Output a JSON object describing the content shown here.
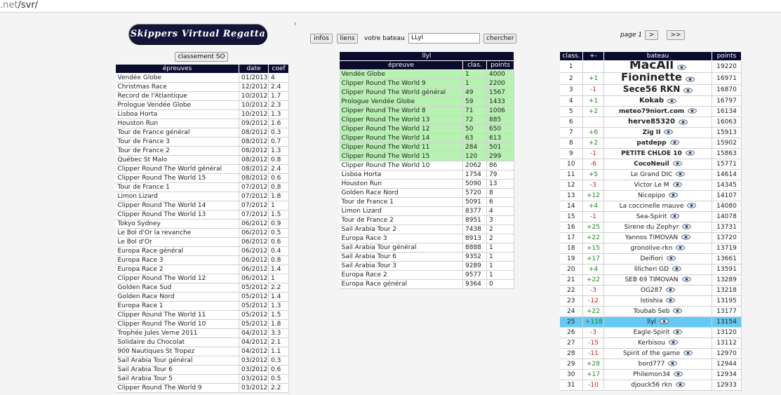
{
  "url": {
    "dim": ".net",
    "path": "/svr/"
  },
  "stray_char": "³",
  "logo_text": "Skippers Virtual Regatta",
  "classement_btn": "classement SO",
  "toolbar": {
    "infos": "infos",
    "liens": "liens",
    "votre_bateau_label": "votre bateau",
    "boat_input_value": "LLyl",
    "chercher": "chercher"
  },
  "pager": {
    "label": "page 1",
    "next": ">",
    "last": ">>"
  },
  "left_table": {
    "headers": [
      "épreuves",
      "date",
      "coef"
    ],
    "rows": [
      [
        "Vendée Globe",
        "01/2013",
        "4"
      ],
      [
        "Christmas Race",
        "12/2012",
        "2.4"
      ],
      [
        "Record de l'Atlantique",
        "10/2012",
        "1.7"
      ],
      [
        "Prologue Vendée Globe",
        "10/2012",
        "2.3"
      ],
      [
        "Lisboa Horta",
        "10/2012",
        "1.3"
      ],
      [
        "Houston Run",
        "09/2012",
        "1.6"
      ],
      [
        "Tour de France général",
        "08/2012",
        "0.3"
      ],
      [
        "Tour de France 3",
        "08/2012",
        "0.7"
      ],
      [
        "Tour de France 2",
        "08/2012",
        "1.3"
      ],
      [
        "Québec St Malo",
        "08/2012",
        "0.8"
      ],
      [
        "Clipper Round The World général",
        "08/2012",
        "2.4"
      ],
      [
        "Clipper Round The World 15",
        "08/2012",
        "0.6"
      ],
      [
        "Tour de France 1",
        "07/2012",
        "0.8"
      ],
      [
        "Limon Lizard",
        "07/2012",
        "1.8"
      ],
      [
        "Clipper Round The World 14",
        "07/2012",
        "1"
      ],
      [
        "Clipper Round The World 13",
        "07/2012",
        "1.5"
      ],
      [
        "Tokyo Sydney",
        "06/2012",
        "0.9"
      ],
      [
        "Le Bol d'Or la revanche",
        "06/2012",
        "0.5"
      ],
      [
        "Le Bol d'Or",
        "06/2012",
        "0.6"
      ],
      [
        "Europa Race général",
        "06/2012",
        "0.4"
      ],
      [
        "Europa Race 3",
        "06/2012",
        "0.8"
      ],
      [
        "Europa Race 2",
        "06/2012",
        "1.4"
      ],
      [
        "Clipper Round The World 12",
        "06/2012",
        "1"
      ],
      [
        "Golden Race Sud",
        "05/2012",
        "2.2"
      ],
      [
        "Golden Race Nord",
        "05/2012",
        "1.4"
      ],
      [
        "Europa Race 1",
        "05/2012",
        "1.3"
      ],
      [
        "Clipper Round The World 11",
        "05/2012",
        "1.5"
      ],
      [
        "Clipper Round The World 10",
        "05/2012",
        "1.8"
      ],
      [
        "Trophée Jules Verne 2011",
        "04/2012",
        "3.3"
      ],
      [
        "Solidaire du Chocolat",
        "04/2012",
        "2.1"
      ],
      [
        "900 Nautiques St Tropez",
        "04/2012",
        "1.1"
      ],
      [
        "Sail Arabia Tour général",
        "03/2012",
        "0.3"
      ],
      [
        "Sail Arabia Tour 6",
        "03/2012",
        "0.6"
      ],
      [
        "Sail Arabia Tour 5",
        "03/2012",
        "0.5"
      ],
      [
        "Clipper Round The World 9",
        "03/2012",
        "2.2"
      ]
    ]
  },
  "mid_table": {
    "boat_name": "llyl",
    "headers": [
      "épreuve",
      "clas.",
      "points"
    ],
    "rows": [
      {
        "race": "Vendée Globe",
        "clas": "1",
        "points": "4000",
        "hl": true
      },
      {
        "race": "Clipper Round The World 9",
        "clas": "1",
        "points": "2200",
        "hl": true
      },
      {
        "race": "Clipper Round The World général",
        "clas": "49",
        "points": "1567",
        "hl": true
      },
      {
        "race": "Prologue Vendée Globe",
        "clas": "59",
        "points": "1433",
        "hl": true
      },
      {
        "race": "Clipper Round The World 8",
        "clas": "71",
        "points": "1006",
        "hl": true
      },
      {
        "race": "Clipper Round The World 13",
        "clas": "72",
        "points": "885",
        "hl": true
      },
      {
        "race": "Clipper Round The World 12",
        "clas": "50",
        "points": "650",
        "hl": true
      },
      {
        "race": "Clipper Round The World 14",
        "clas": "63",
        "points": "613",
        "hl": true
      },
      {
        "race": "Clipper Round The World 11",
        "clas": "284",
        "points": "501",
        "hl": true
      },
      {
        "race": "Clipper Round The World 15",
        "clas": "120",
        "points": "299",
        "hl": true
      },
      {
        "race": "Clipper Round The World 10",
        "clas": "2062",
        "points": "86",
        "hl": false
      },
      {
        "race": "Lisboa Horta",
        "clas": "1754",
        "points": "79",
        "hl": false
      },
      {
        "race": "Houston Run",
        "clas": "5090",
        "points": "13",
        "hl": false
      },
      {
        "race": "Golden Race Nord",
        "clas": "5720",
        "points": "8",
        "hl": false
      },
      {
        "race": "Tour de France 1",
        "clas": "5091",
        "points": "6",
        "hl": false
      },
      {
        "race": "Limon Lizard",
        "clas": "8377",
        "points": "4",
        "hl": false
      },
      {
        "race": "Tour de France 2",
        "clas": "8951",
        "points": "3",
        "hl": false
      },
      {
        "race": "Sail Arabia Tour 2",
        "clas": "7438",
        "points": "2",
        "hl": false
      },
      {
        "race": "Europa Race 3",
        "clas": "8913",
        "points": "2",
        "hl": false
      },
      {
        "race": "Sail Arabia Tour général",
        "clas": "8888",
        "points": "1",
        "hl": false
      },
      {
        "race": "Sail Arabia Tour 6",
        "clas": "9352",
        "points": "1",
        "hl": false
      },
      {
        "race": "Sail Arabia Tour 3",
        "clas": "9289",
        "points": "1",
        "hl": false
      },
      {
        "race": "Europa Race 2",
        "clas": "9577",
        "points": "1",
        "hl": false
      },
      {
        "race": "Europa Race général",
        "clas": "9364",
        "points": "0",
        "hl": false
      }
    ]
  },
  "right_table": {
    "headers": [
      "class.",
      "+-",
      "bateau",
      "points"
    ],
    "colors": {
      "positive": "#1a8a1a",
      "negative": "#d02020",
      "highlight": "#65c9f4"
    },
    "rows": [
      {
        "rank": "1",
        "delta": "",
        "boat": "MacAll",
        "points": "19220",
        "size": 17,
        "bold": true
      },
      {
        "rank": "2",
        "delta": "+1",
        "boat": "Fioninette",
        "points": "16971",
        "size": 15,
        "bold": true
      },
      {
        "rank": "3",
        "delta": "-1",
        "boat": "Sece56 RKN",
        "points": "16870",
        "size": 12,
        "bold": true
      },
      {
        "rank": "4",
        "delta": "+1",
        "boat": "Kokab",
        "points": "16797",
        "size": 10,
        "bold": true
      },
      {
        "rank": "5",
        "delta": "+2",
        "boat": "meteo79niort.com",
        "points": "16134",
        "size": 9,
        "bold": true
      },
      {
        "rank": "6",
        "delta": "",
        "boat": "herve85320",
        "points": "16063",
        "size": 10,
        "bold": true
      },
      {
        "rank": "7",
        "delta": "+6",
        "boat": "Zig II",
        "points": "15913",
        "size": 9,
        "bold": true
      },
      {
        "rank": "8",
        "delta": "+2",
        "boat": "patdepp",
        "points": "15902",
        "size": 9,
        "bold": true
      },
      {
        "rank": "9",
        "delta": "-1",
        "boat": "PETITE CHLOE 10",
        "points": "15863",
        "size": 9,
        "bold": true
      },
      {
        "rank": "10",
        "delta": "-6",
        "boat": "CocoNeuil",
        "points": "15771",
        "size": 9,
        "bold": true
      },
      {
        "rank": "11",
        "delta": "+5",
        "boat": "Le Grand DIC",
        "points": "14614",
        "size": 9,
        "bold": false
      },
      {
        "rank": "12",
        "delta": "-3",
        "boat": "Victor Le M",
        "points": "14345",
        "size": 9,
        "bold": false
      },
      {
        "rank": "13",
        "delta": "+12",
        "boat": "Nicopipo",
        "points": "14107",
        "size": 9,
        "bold": false
      },
      {
        "rank": "14",
        "delta": "+4",
        "boat": "La coccinelle mauve",
        "points": "14080",
        "size": 9,
        "bold": false
      },
      {
        "rank": "15",
        "delta": "-1",
        "boat": "Sea-Spirit",
        "points": "14078",
        "size": 9,
        "bold": false
      },
      {
        "rank": "16",
        "delta": "+25",
        "boat": "Sirene du Zephyr",
        "points": "13731",
        "size": 9,
        "bold": false
      },
      {
        "rank": "17",
        "delta": "+22",
        "boat": "Yannos TIMOVAN",
        "points": "13720",
        "size": 9,
        "bold": false
      },
      {
        "rank": "18",
        "delta": "+15",
        "boat": "gronolive-rkn",
        "points": "13719",
        "size": 9,
        "bold": false
      },
      {
        "rank": "19",
        "delta": "+17",
        "boat": "Deifiori",
        "points": "13661",
        "size": 9,
        "bold": false
      },
      {
        "rank": "20",
        "delta": "+4",
        "boat": "lilicheri GD",
        "points": "13591",
        "size": 9,
        "bold": false
      },
      {
        "rank": "21",
        "delta": "+22",
        "boat": "SEB 69 TIMOVAN",
        "points": "13289",
        "size": 9,
        "bold": false
      },
      {
        "rank": "22",
        "delta": "-3",
        "boat": "OG287",
        "points": "13218",
        "size": 9,
        "bold": false
      },
      {
        "rank": "23",
        "delta": "-12",
        "boat": "Istishia",
        "points": "13195",
        "size": 9,
        "bold": false
      },
      {
        "rank": "24",
        "delta": "+22",
        "boat": "Toubab Seb",
        "points": "13177",
        "size": 9,
        "bold": false
      },
      {
        "rank": "25",
        "delta": "+118",
        "boat": "llyl",
        "points": "13154",
        "size": 9,
        "bold": false,
        "me": true
      },
      {
        "rank": "26",
        "delta": "-3",
        "boat": "Eagle-Spirit",
        "points": "13120",
        "size": 9,
        "bold": false
      },
      {
        "rank": "27",
        "delta": "-15",
        "boat": "Kerbisou",
        "points": "13112",
        "size": 9,
        "bold": false
      },
      {
        "rank": "28",
        "delta": "-11",
        "boat": "Spirit of the game",
        "points": "12970",
        "size": 9,
        "bold": false
      },
      {
        "rank": "29",
        "delta": "+28",
        "boat": "bord777",
        "points": "12944",
        "size": 9,
        "bold": false
      },
      {
        "rank": "30",
        "delta": "+17",
        "boat": "Philemon34",
        "points": "12934",
        "size": 9,
        "bold": false
      },
      {
        "rank": "31",
        "delta": "-10",
        "boat": "djouck56 rkn",
        "points": "12933",
        "size": 9,
        "bold": false
      }
    ]
  }
}
